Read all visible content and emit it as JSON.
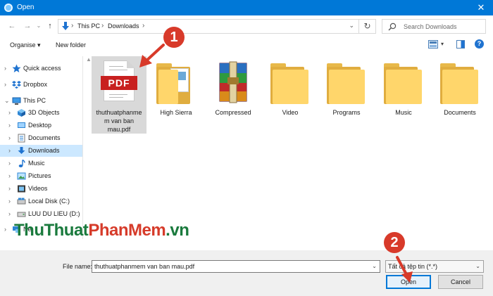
{
  "window": {
    "title": "Open",
    "close_glyph": "✕"
  },
  "address": {
    "crumbs": [
      "This PC",
      "Downloads"
    ],
    "search_placeholder": "Search Downloads"
  },
  "toolbar": {
    "organise": "Organise ▾",
    "new_folder": "New folder",
    "help": "?"
  },
  "nav": {
    "items": [
      {
        "label": "Quick access",
        "icon": "star-icon"
      },
      {
        "label": "Dropbox",
        "icon": "dropbox-icon"
      },
      {
        "label": "This PC",
        "icon": "pc-icon"
      },
      {
        "label": "3D Objects",
        "icon": "cube-icon"
      },
      {
        "label": "Desktop",
        "icon": "desktop-icon"
      },
      {
        "label": "Documents",
        "icon": "document-icon"
      },
      {
        "label": "Downloads",
        "icon": "download-icon"
      },
      {
        "label": "Music",
        "icon": "music-icon"
      },
      {
        "label": "Pictures",
        "icon": "pictures-icon"
      },
      {
        "label": "Videos",
        "icon": "videos-icon"
      },
      {
        "label": "Local Disk (C:)",
        "icon": "drive-icon"
      },
      {
        "label": "LUU DU LIEU (D:)",
        "icon": "drive-icon"
      },
      {
        "label": "Ne",
        "icon": "network-icon"
      }
    ]
  },
  "files": [
    {
      "name": "thuthuatphanmem van ban mau.pdf",
      "name_lines": [
        "thuthuatphanme",
        "m van ban",
        "mau.pdf"
      ],
      "type": "pdf"
    },
    {
      "name": "High Sierra",
      "type": "folder"
    },
    {
      "name": "Compressed",
      "type": "archive"
    },
    {
      "name": "Video",
      "type": "folder"
    },
    {
      "name": "Programs",
      "type": "folder"
    },
    {
      "name": "Music",
      "type": "folder"
    },
    {
      "name": "Documents",
      "type": "folder"
    }
  ],
  "pdf_label": "PDF",
  "file_name": {
    "label": "File name:",
    "value": "thuthuatphanmem van ban mau.pdf"
  },
  "filter": {
    "value": "Tất cả tệp tin (*.*)"
  },
  "buttons": {
    "open": "Open",
    "cancel": "Cancel"
  },
  "annotations": {
    "badge1": "1",
    "badge2": "2",
    "accent": "#d83a2a"
  },
  "watermark": {
    "part1": "ThuThuat",
    "part2": "PhanMem",
    "part3": ".vn"
  }
}
